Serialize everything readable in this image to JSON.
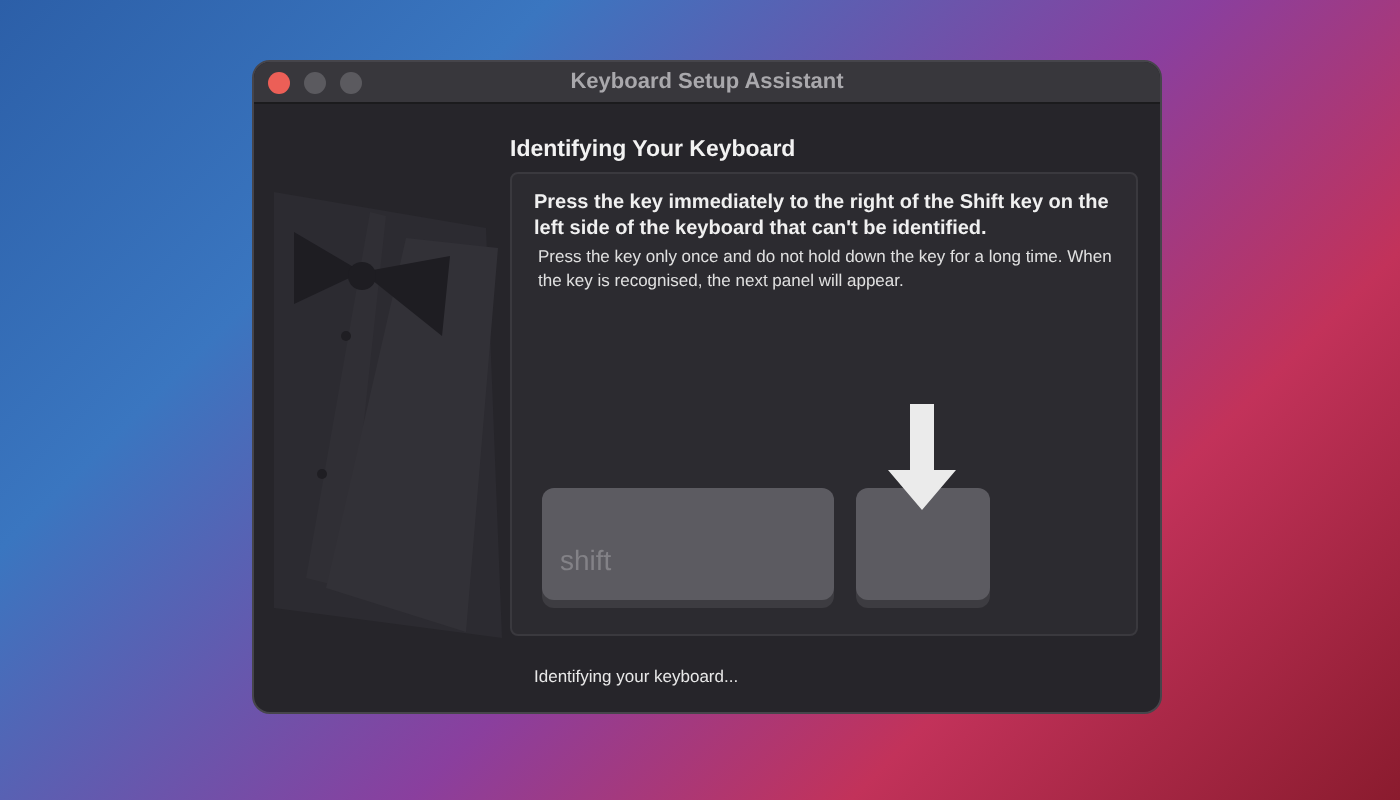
{
  "window": {
    "title": "Keyboard Setup Assistant"
  },
  "heading": "Identifying Your Keyboard",
  "instruction": "Press the key immediately to the right of the Shift key on the left side of the keyboard that can't be identified.",
  "detail": "Press the key only once and do not hold down the key for a long time. When the key is recognised, the next panel will appear.",
  "keys": [
    {
      "kind": "shift",
      "label": "shift"
    },
    {
      "kind": "target"
    }
  ],
  "status": "Identifying your keyboard..."
}
